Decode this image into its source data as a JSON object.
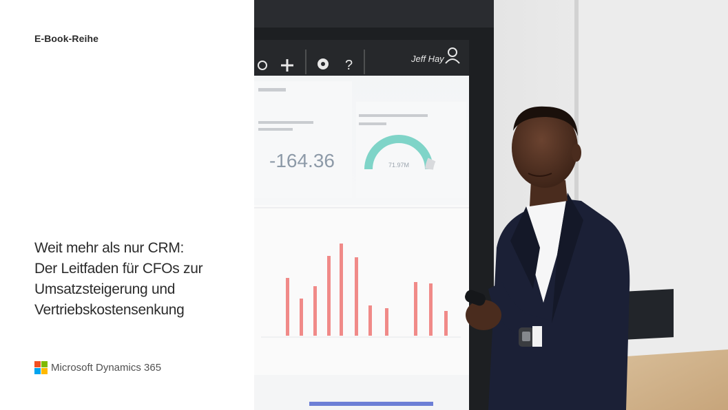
{
  "cover": {
    "series_label": "E-Book-Reihe",
    "title_lines": [
      "Weit mehr als nur CRM:",
      "Der Leitfaden für CFOs zur",
      "Umsatzsteigerung und",
      "Vertriebskostensenkung"
    ],
    "brand_name": "Microsoft Dynamics 365",
    "logo_colors": [
      "#f25022",
      "#7fba00",
      "#00a4ef",
      "#ffb900"
    ]
  },
  "photo": {
    "description_icons": [
      "lightbulb-icon",
      "plus-icon",
      "settings-icon",
      "help-icon",
      "user-icon"
    ],
    "screen": {
      "user_name": "Jeff Hay",
      "kpi_value": "-164.36",
      "gauge_value": "71.97M",
      "bar_color": "#f08a88"
    }
  }
}
